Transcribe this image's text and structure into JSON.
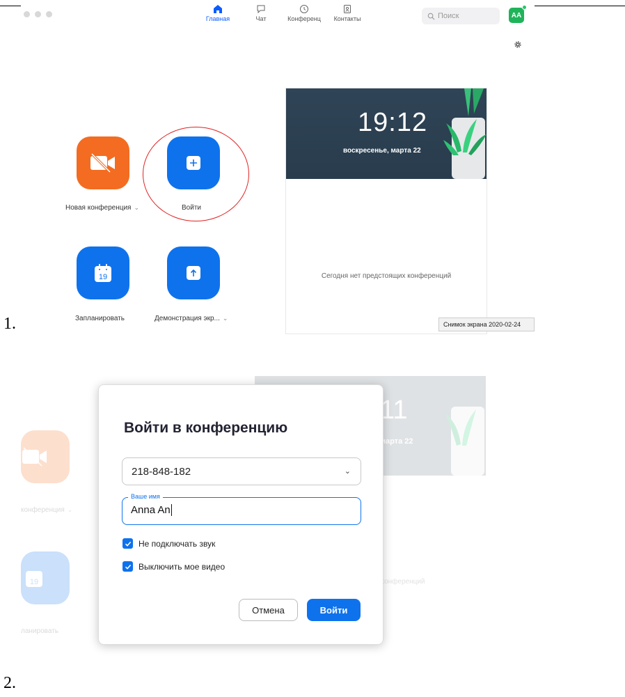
{
  "step_labels": [
    "1.",
    "2."
  ],
  "screen1": {
    "nav": [
      {
        "label": "Главная",
        "icon": "home-icon",
        "active": true
      },
      {
        "label": "Чат",
        "icon": "chat-icon",
        "active": false
      },
      {
        "label": "Конференц",
        "icon": "clock-icon",
        "active": false
      },
      {
        "label": "Контакты",
        "icon": "contacts-icon",
        "active": false
      }
    ],
    "search_placeholder": "Поиск",
    "avatar_initials": "AA",
    "actions": {
      "new_meeting": "Новая конференция",
      "join": "Войти",
      "schedule": "Запланировать",
      "schedule_day": "19",
      "share_screen": "Демонстрация экр..."
    },
    "calendar": {
      "time": "19:12",
      "date": "воскресенье, марта 22",
      "empty_text": "Сегодня нет предстоящих конференций"
    },
    "tooltip": "Снимок экрана 2020-02-24",
    "colors": {
      "accent": "#0e72ed",
      "orange": "#f36c21",
      "highlight_ring": "#e02020"
    }
  },
  "screen2": {
    "background": {
      "time": "11",
      "date": "марта 22",
      "empty_text": "щих конференций",
      "new_meeting": "конференция",
      "schedule": "ланировать",
      "schedule_day": "19"
    },
    "dialog": {
      "title": "Войти в конференцию",
      "meeting_id": "218-848-182",
      "name_label": "Ваше имя",
      "name_value": "Anna An",
      "option_audio": "Не подключать звук",
      "option_video": "Выключить мое видео",
      "cancel": "Отмена",
      "join": "Войти"
    }
  }
}
